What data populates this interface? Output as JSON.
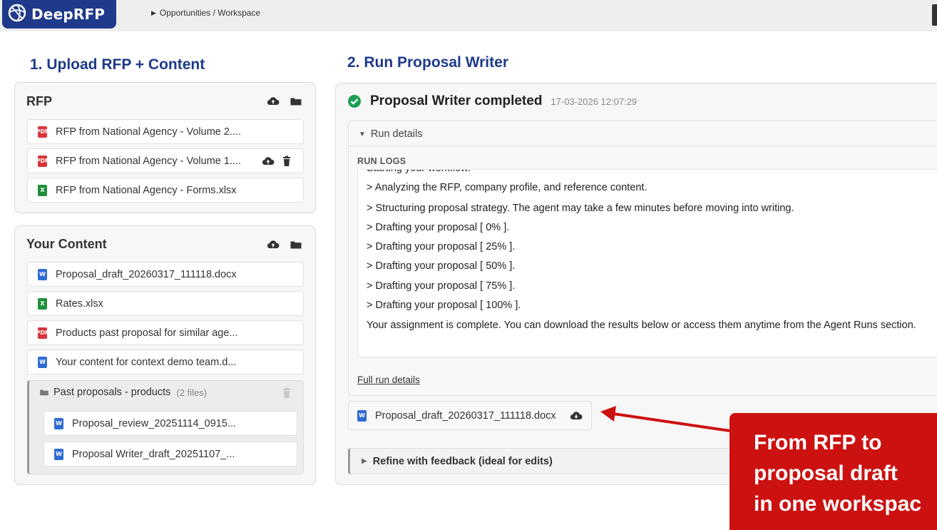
{
  "app": {
    "name": "DeepRFP"
  },
  "breadcrumb": "Opportunities / Workspace",
  "sections": {
    "upload_title": "1. Upload RFP + Content",
    "run_title": "2. Run Proposal Writer"
  },
  "rfp": {
    "title": "RFP",
    "files": [
      {
        "name": "RFP from National Agency - Volume 2....",
        "type": "pdf"
      },
      {
        "name": "RFP from National Agency - Volume 1....",
        "type": "pdf"
      },
      {
        "name": "RFP from National Agency - Forms.xlsx",
        "type": "xlsx"
      }
    ]
  },
  "content": {
    "title": "Your Content",
    "files": [
      {
        "name": "Proposal_draft_20260317_111118.docx",
        "type": "docx"
      },
      {
        "name": "Rates.xlsx",
        "type": "xlsx"
      },
      {
        "name": "Products past proposal for similar age...",
        "type": "pdf"
      },
      {
        "name": "Your content for context demo team.d...",
        "type": "docx"
      }
    ],
    "folder": {
      "name": "Past proposals - products",
      "count": "(2 files)",
      "files": [
        {
          "name": "Proposal_review_20251114_0915...",
          "type": "docx"
        },
        {
          "name": "Proposal Writer_draft_20251107_...",
          "type": "docx"
        }
      ]
    }
  },
  "run": {
    "status": "Proposal Writer completed",
    "timestamp": "17-03-2026 12:07:29",
    "details_label": "Run details",
    "logs_label": "RUN LOGS",
    "logs": [
      "Starting your workflow.",
      "> Analyzing the RFP, company profile, and reference content.",
      "> Structuring proposal strategy. The agent may take a few minutes before moving into writing.",
      "> Drafting your proposal [ 0% ].",
      "> Drafting your proposal [ 25% ].",
      "> Drafting your proposal [ 50% ].",
      "> Drafting your proposal [ 75% ].",
      "> Drafting your proposal [ 100% ]."
    ],
    "final_message": "Your assignment is complete. You can download the results below or access them anytime from the Agent Runs section.",
    "full_details_link": "Full run details",
    "output_file": "Proposal_draft_20260317_111118.docx",
    "refine_label": "Refine with feedback (ideal for edits)"
  },
  "callout": {
    "lines": [
      "From RFP to",
      "proposal draft",
      "in one workspac"
    ]
  },
  "colors": {
    "brand": "#1f3a8a",
    "heading": "#1e3a8a",
    "success": "#1e9e55",
    "callout": "#cc1111",
    "pdf": "#d9343a",
    "xlsx": "#1f8f3a",
    "docx": "#2f6cd1"
  },
  "icons": {
    "logo": "logo-icon",
    "upload": "cloud-upload-icon",
    "folder": "folder-icon",
    "delete": "trash-icon",
    "download": "cloud-download-icon",
    "success": "check-circle-icon"
  }
}
